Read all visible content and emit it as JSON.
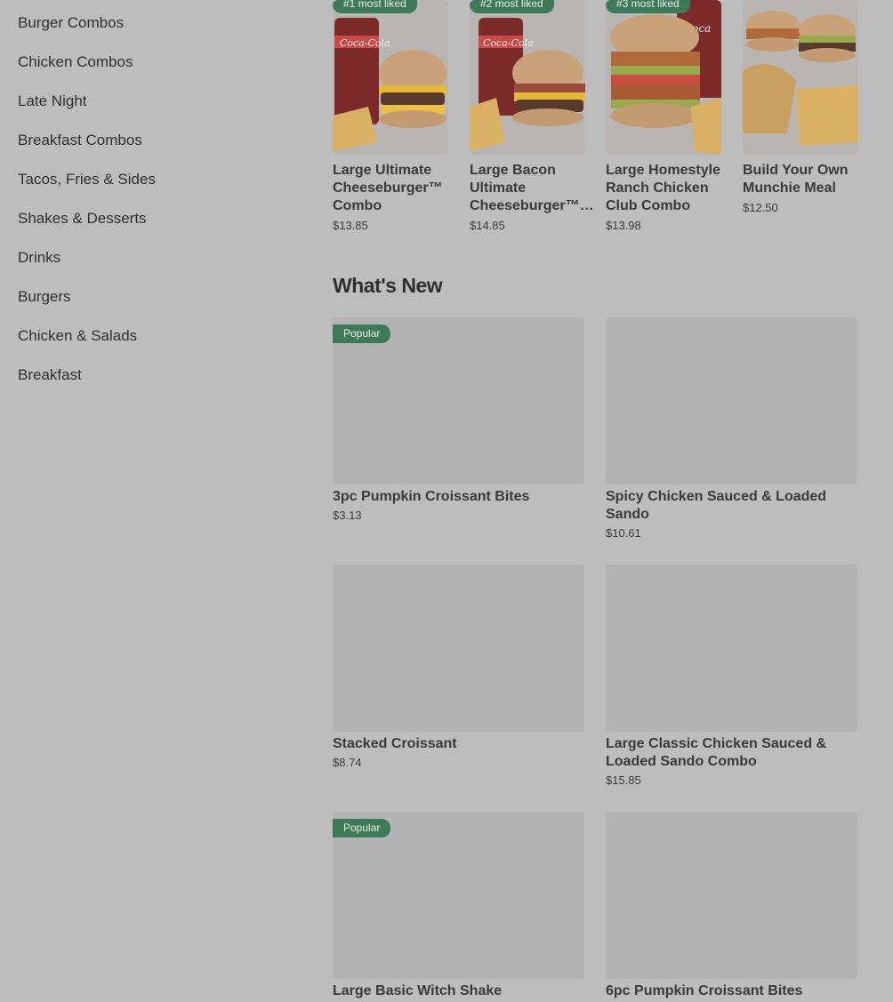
{
  "sidebar": {
    "items": [
      {
        "label": "Burger Combos"
      },
      {
        "label": "Chicken Combos"
      },
      {
        "label": "Late Night"
      },
      {
        "label": "Breakfast Combos"
      },
      {
        "label": "Tacos, Fries & Sides"
      },
      {
        "label": "Shakes & Desserts"
      },
      {
        "label": "Drinks"
      },
      {
        "label": "Burgers"
      },
      {
        "label": "Chicken & Salads"
      },
      {
        "label": "Breakfast"
      }
    ]
  },
  "most_liked": [
    {
      "badge": "#1 most liked",
      "name": "Large Ultimate Cheeseburger™ Combo",
      "price": "$13.85",
      "image": "ultimate-cheeseburger-combo-photo"
    },
    {
      "badge": "#2 most liked",
      "name": "Large Bacon Ultimate Cheeseburger™…",
      "price": "$14.85",
      "image": "bacon-ultimate-cheeseburger-combo-photo"
    },
    {
      "badge": "#3 most liked",
      "name": "Large Homestyle Ranch Chicken Club Combo",
      "price": "$13.98",
      "image": "homestyle-ranch-chicken-combo-photo"
    },
    {
      "badge": "",
      "name": "Build Your Own Munchie Meal",
      "price": "$12.50",
      "image": "munchie-meal-photo"
    }
  ],
  "whats_new": {
    "title": "What's New",
    "items": [
      {
        "badge": "Popular",
        "name": "3pc Pumpkin Croissant Bites",
        "price": "$3.13"
      },
      {
        "badge": "",
        "name": "Spicy Chicken Sauced & Loaded Sando",
        "price": "$10.61"
      },
      {
        "badge": "",
        "name": "Stacked Croissant",
        "price": "$8.74"
      },
      {
        "badge": "",
        "name": "Large Classic Chicken Sauced & Loaded Sando Combo",
        "price": "$15.85"
      },
      {
        "badge": "Popular",
        "name": "Large Basic Witch Shake",
        "price": ""
      },
      {
        "badge": "",
        "name": "6pc Pumpkin Croissant Bites",
        "price": ""
      }
    ]
  },
  "brand": {
    "badge_color": "#3e7a58",
    "cola_logo": "Coca-Cola"
  }
}
